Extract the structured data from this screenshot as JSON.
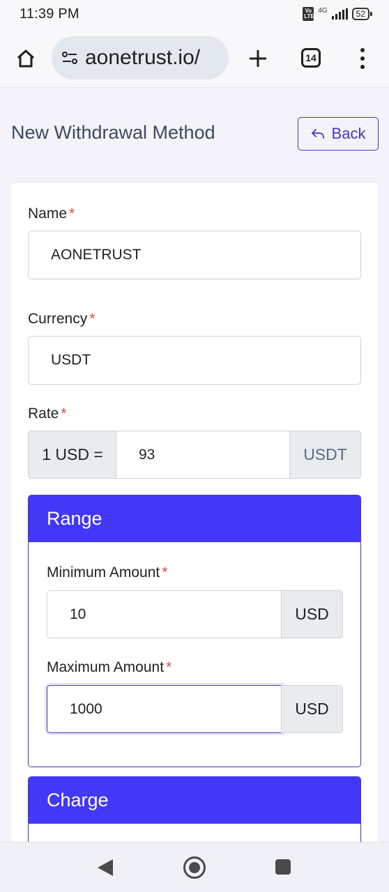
{
  "status_bar": {
    "time": "11:39 PM",
    "volte": "Vo LTE",
    "network": "4G",
    "battery": "52"
  },
  "browser": {
    "url": "aonetrust.io/",
    "tab_count": "14"
  },
  "page": {
    "title": "New Withdrawal Method",
    "back_label": "Back"
  },
  "form": {
    "name_label": "Name",
    "name_value": "AONETRUST",
    "currency_label": "Currency",
    "currency_value": "USDT",
    "rate_label": "Rate",
    "rate_prefix": "1 USD =",
    "rate_value": "93",
    "rate_suffix": "USDT",
    "required_mark": "*"
  },
  "range": {
    "title": "Range",
    "min_label": "Minimum Amount",
    "min_value": "10",
    "min_unit": "USD",
    "max_label": "Maximum Amount",
    "max_value": "1000",
    "max_unit": "USD"
  },
  "charge": {
    "title": "Charge"
  },
  "colors": {
    "accent": "#4338f5",
    "required": "#e24b4b"
  }
}
